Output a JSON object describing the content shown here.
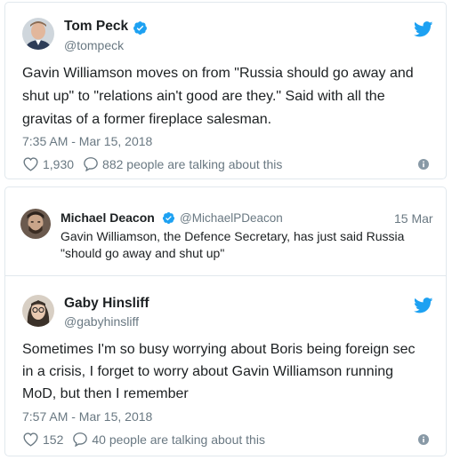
{
  "tweet1": {
    "name": "Tom Peck",
    "handle": "@tompeck",
    "text_line1": "Gavin Williamson moves on from \"Russia should go away and",
    "text_line2": "shut up\" to \"relations ain't good are they.\" Said with all the",
    "text_line3": "gravitas of a former fireplace salesman.",
    "timestamp": "7:35 AM - Mar 15, 2018",
    "likes": "1,930",
    "talking": "882 people are talking about this"
  },
  "tweet2": {
    "quoted": {
      "name": "Michael Deacon",
      "handle": "@MichaelPDeacon",
      "date": "15 Mar",
      "text_line1": "Gavin Williamson, the Defence Secretary, has just said Russia",
      "text_line2": "\"should go away and shut up\""
    },
    "name": "Gaby Hinsliff",
    "handle": "@gabyhinsliff",
    "text_line1": "Sometimes I'm so busy worrying about Boris being foreign sec",
    "text_line2": "in a crisis, I forget to worry about Gavin Williamson running",
    "text_line3": "MoD, but then I remember",
    "timestamp": "7:57 AM - Mar 15, 2018",
    "likes": "152",
    "talking": "40 people are talking about this"
  },
  "colors": {
    "verified": "#1da1f2",
    "bird": "#1da1f2",
    "muted": "#697882",
    "border": "#e1e8ed"
  },
  "icons": [
    "verified-badge-icon",
    "twitter-bird-icon",
    "heart-icon",
    "reply-bubble-icon",
    "info-icon"
  ]
}
